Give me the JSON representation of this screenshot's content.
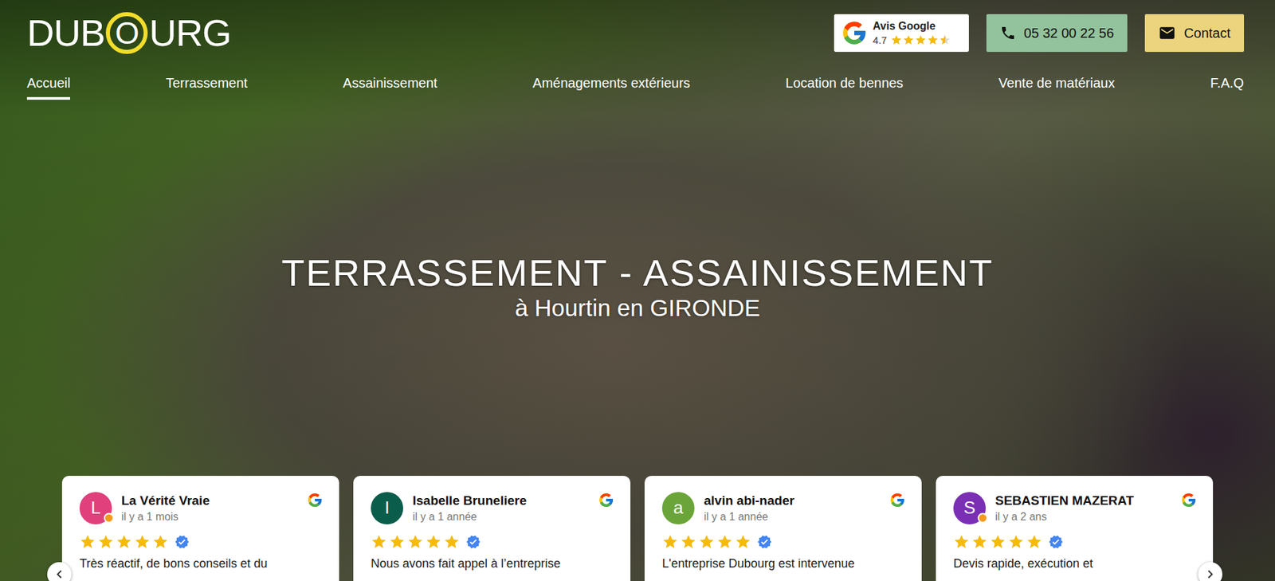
{
  "header": {
    "logo": {
      "before": "DUB",
      "ring": "O",
      "after": "URG"
    },
    "google_rating": {
      "label": "Avis Google",
      "rating": "4.7",
      "stars": 4.5
    },
    "phone": "05 32 00 22 56",
    "contact": "Contact"
  },
  "nav": [
    {
      "label": "Accueil",
      "selected": true
    },
    {
      "label": "Terrassement",
      "selected": false
    },
    {
      "label": "Assainissement",
      "selected": false
    },
    {
      "label": "Aménagements extérieurs",
      "selected": false
    },
    {
      "label": "Location de bennes",
      "selected": false
    },
    {
      "label": "Vente de matériaux",
      "selected": false
    },
    {
      "label": "F.A.Q",
      "selected": false
    }
  ],
  "hero": {
    "title": "TERRASSEMENT - ASSAINISSEMENT",
    "subtitle": "à Hourtin en GIRONDE"
  },
  "reviews": [
    {
      "author": "La Vérité Vraie",
      "initial": "L",
      "time": "il y a 1 mois",
      "stars": 5,
      "verified": true,
      "local_guide": true,
      "color": "#e0407b",
      "text": "Très réactif, de bons conseils et du"
    },
    {
      "author": "Isabelle Bruneliere",
      "initial": "I",
      "time": "il y a 1 année",
      "stars": 5,
      "verified": true,
      "local_guide": false,
      "color": "#0b5d4b",
      "text": "Nous avons fait appel à l’entreprise"
    },
    {
      "author": "alvin abi-nader",
      "initial": "a",
      "time": "il y a 1 année",
      "stars": 5,
      "verified": true,
      "local_guide": false,
      "color": "#6ba539",
      "text": "L'entreprise Dubourg est intervenue"
    },
    {
      "author": "SEBASTIEN MAZERAT",
      "initial": "S",
      "time": "il y a 2 ans",
      "stars": 5,
      "verified": true,
      "local_guide": true,
      "color": "#7b2fb5",
      "text": "Devis rapide, exécution et"
    }
  ]
}
